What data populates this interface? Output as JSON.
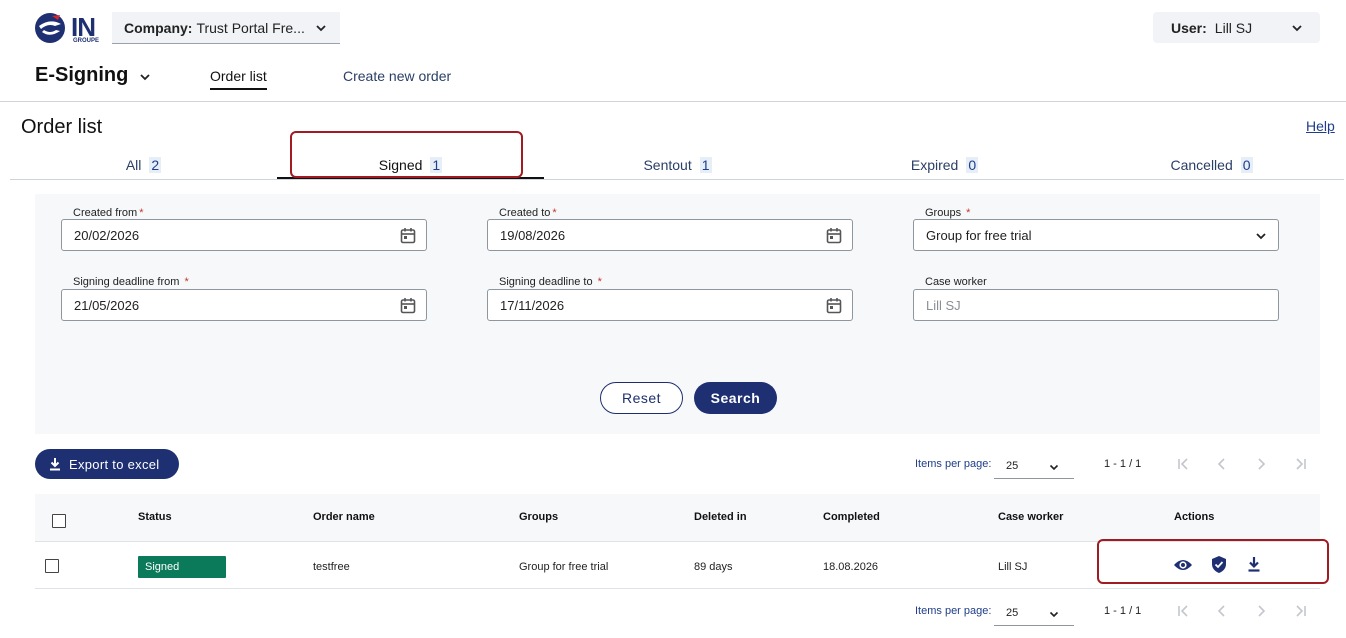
{
  "header": {
    "logo_text": "IN",
    "logo_sub": "GROUPE",
    "company_label": "Company:",
    "company_value": "Trust Portal Fre...",
    "user_label": "User:",
    "user_value": "Lill SJ"
  },
  "nav": {
    "app_title": "E-Signing",
    "order_list": "Order list",
    "create_new_order": "Create new order"
  },
  "page": {
    "title": "Order list",
    "help": "Help"
  },
  "tabs": [
    {
      "label": "All",
      "count": "2"
    },
    {
      "label": "Signed",
      "count": "1"
    },
    {
      "label": "Sentout",
      "count": "1"
    },
    {
      "label": "Expired",
      "count": "0"
    },
    {
      "label": "Cancelled",
      "count": "0"
    }
  ],
  "filters": {
    "created_from": {
      "label": "Created from",
      "req": "*",
      "value": "20/02/2026"
    },
    "created_to": {
      "label": "Created to",
      "req": "*",
      "value": "19/08/2026"
    },
    "groups": {
      "label": "Groups",
      "req": "*",
      "value": "Group for free trial"
    },
    "signing_from": {
      "label": "Signing deadline from",
      "req": "*",
      "value": "21/05/2026"
    },
    "signing_to": {
      "label": "Signing deadline to",
      "req": "*",
      "value": "17/11/2026"
    },
    "case_worker": {
      "label": "Case worker",
      "placeholder": "Lill SJ"
    }
  },
  "buttons": {
    "reset": "Reset",
    "search": "Search",
    "export": "Export to excel"
  },
  "paginator": {
    "items_per_page_label": "Items per page:",
    "items_per_page": "25",
    "range": "1 - 1 / 1"
  },
  "table": {
    "headers": [
      "Status",
      "Order name",
      "Groups",
      "Deleted in",
      "Completed",
      "Case worker",
      "Actions"
    ],
    "rows": [
      {
        "status": "Signed",
        "order_name": "testfree",
        "groups": "Group for free trial",
        "deleted_in": "89 days",
        "completed": "18.08.2026",
        "case_worker": "Lill SJ"
      }
    ]
  },
  "colors": {
    "primary": "#1e2f72",
    "signed_badge": "#0b7a5a",
    "highlight": "#a01b22"
  },
  "icons": [
    "chevron-down-icon",
    "calendar-icon",
    "download-icon",
    "eye-icon",
    "shield-check-icon",
    "first-page-icon",
    "prev-page-icon",
    "next-page-icon",
    "last-page-icon"
  ]
}
